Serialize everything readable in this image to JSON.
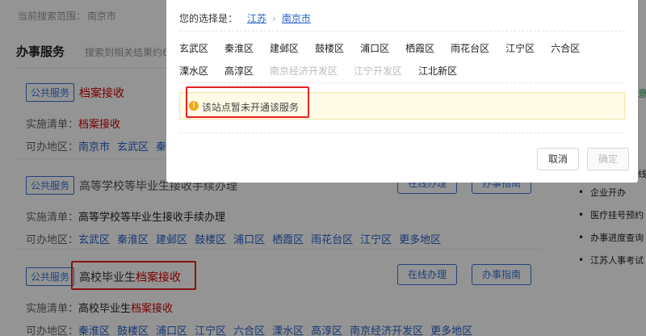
{
  "background": {
    "scope_label": "当前搜索范围：",
    "scope_value": "南京市",
    "section_title": "办事服务",
    "section_sub": "搜索到相关结果约6",
    "cards": [
      {
        "tag": "公共服务",
        "title_prefix": "",
        "title_highlight": "档案接收",
        "list_label": "实施清单：",
        "list_prefix": "",
        "list_highlight": "档案接收",
        "areas_label": "可办地区：",
        "areas": [
          "南京市",
          "玄武区",
          "秦"
        ]
      },
      {
        "tag": "公共服务",
        "title_prefix": "高等学校等毕业生接收手续办理",
        "title_highlight": "",
        "list_label": "实施清单：",
        "list_prefix": "高等学校等毕业生接收手续办理",
        "list_highlight": "",
        "areas_label": "可办地区：",
        "areas": [
          "玄武区",
          "秦淮区",
          "建邺区",
          "鼓楼区",
          "浦口区",
          "栖霞区",
          "雨花台区",
          "江宁区",
          "更多地区"
        ],
        "online_btn": "在线办理",
        "guide_btn": "办事指南"
      },
      {
        "tag": "公共服务",
        "title_prefix": "高校毕业生",
        "title_highlight": "档案接收",
        "list_label": "实施清单：",
        "list_prefix": "高校毕业生",
        "list_highlight": "档案接收",
        "areas_label": "可办地区：",
        "areas": [
          "秦淮区",
          "鼓楼区",
          "浦口区",
          "江宁区",
          "六合区",
          "溧水区",
          "高淳区",
          "南京经济开发区",
          "更多地区"
        ],
        "online_btn": "在线办理",
        "guide_btn": "办事指南"
      }
    ],
    "right_head": "线",
    "right_list": [
      "企业开办",
      "医疗挂号预约",
      "办事进度查询",
      "江苏人事考试"
    ],
    "right_green": "意"
  },
  "modal": {
    "selection_label": "您的选择是：",
    "crumbs": [
      "江苏",
      "南京市"
    ],
    "districts": [
      {
        "name": "玄武区",
        "disabled": false
      },
      {
        "name": "秦淮区",
        "disabled": false
      },
      {
        "name": "建邺区",
        "disabled": false
      },
      {
        "name": "鼓楼区",
        "disabled": false
      },
      {
        "name": "浦口区",
        "disabled": false
      },
      {
        "name": "栖霞区",
        "disabled": false
      },
      {
        "name": "雨花台区",
        "disabled": false
      },
      {
        "name": "江宁区",
        "disabled": false
      },
      {
        "name": "六合区",
        "disabled": false
      },
      {
        "name": "溧水区",
        "disabled": false
      },
      {
        "name": "高淳区",
        "disabled": false
      },
      {
        "name": "南京经济开发区",
        "disabled": true
      },
      {
        "name": "江宁开发区",
        "disabled": true
      },
      {
        "name": "江北新区",
        "disabled": false
      }
    ],
    "notice_icon": "!",
    "notice": "该站点暂未开通该服务",
    "cancel": "取消",
    "confirm": "确定"
  },
  "colors": {
    "link": "#2a62c9",
    "highlight": "#d00000",
    "annotation": "#e62222",
    "notice_bg": "#fffbe6",
    "warning_icon": "#f3a712"
  }
}
